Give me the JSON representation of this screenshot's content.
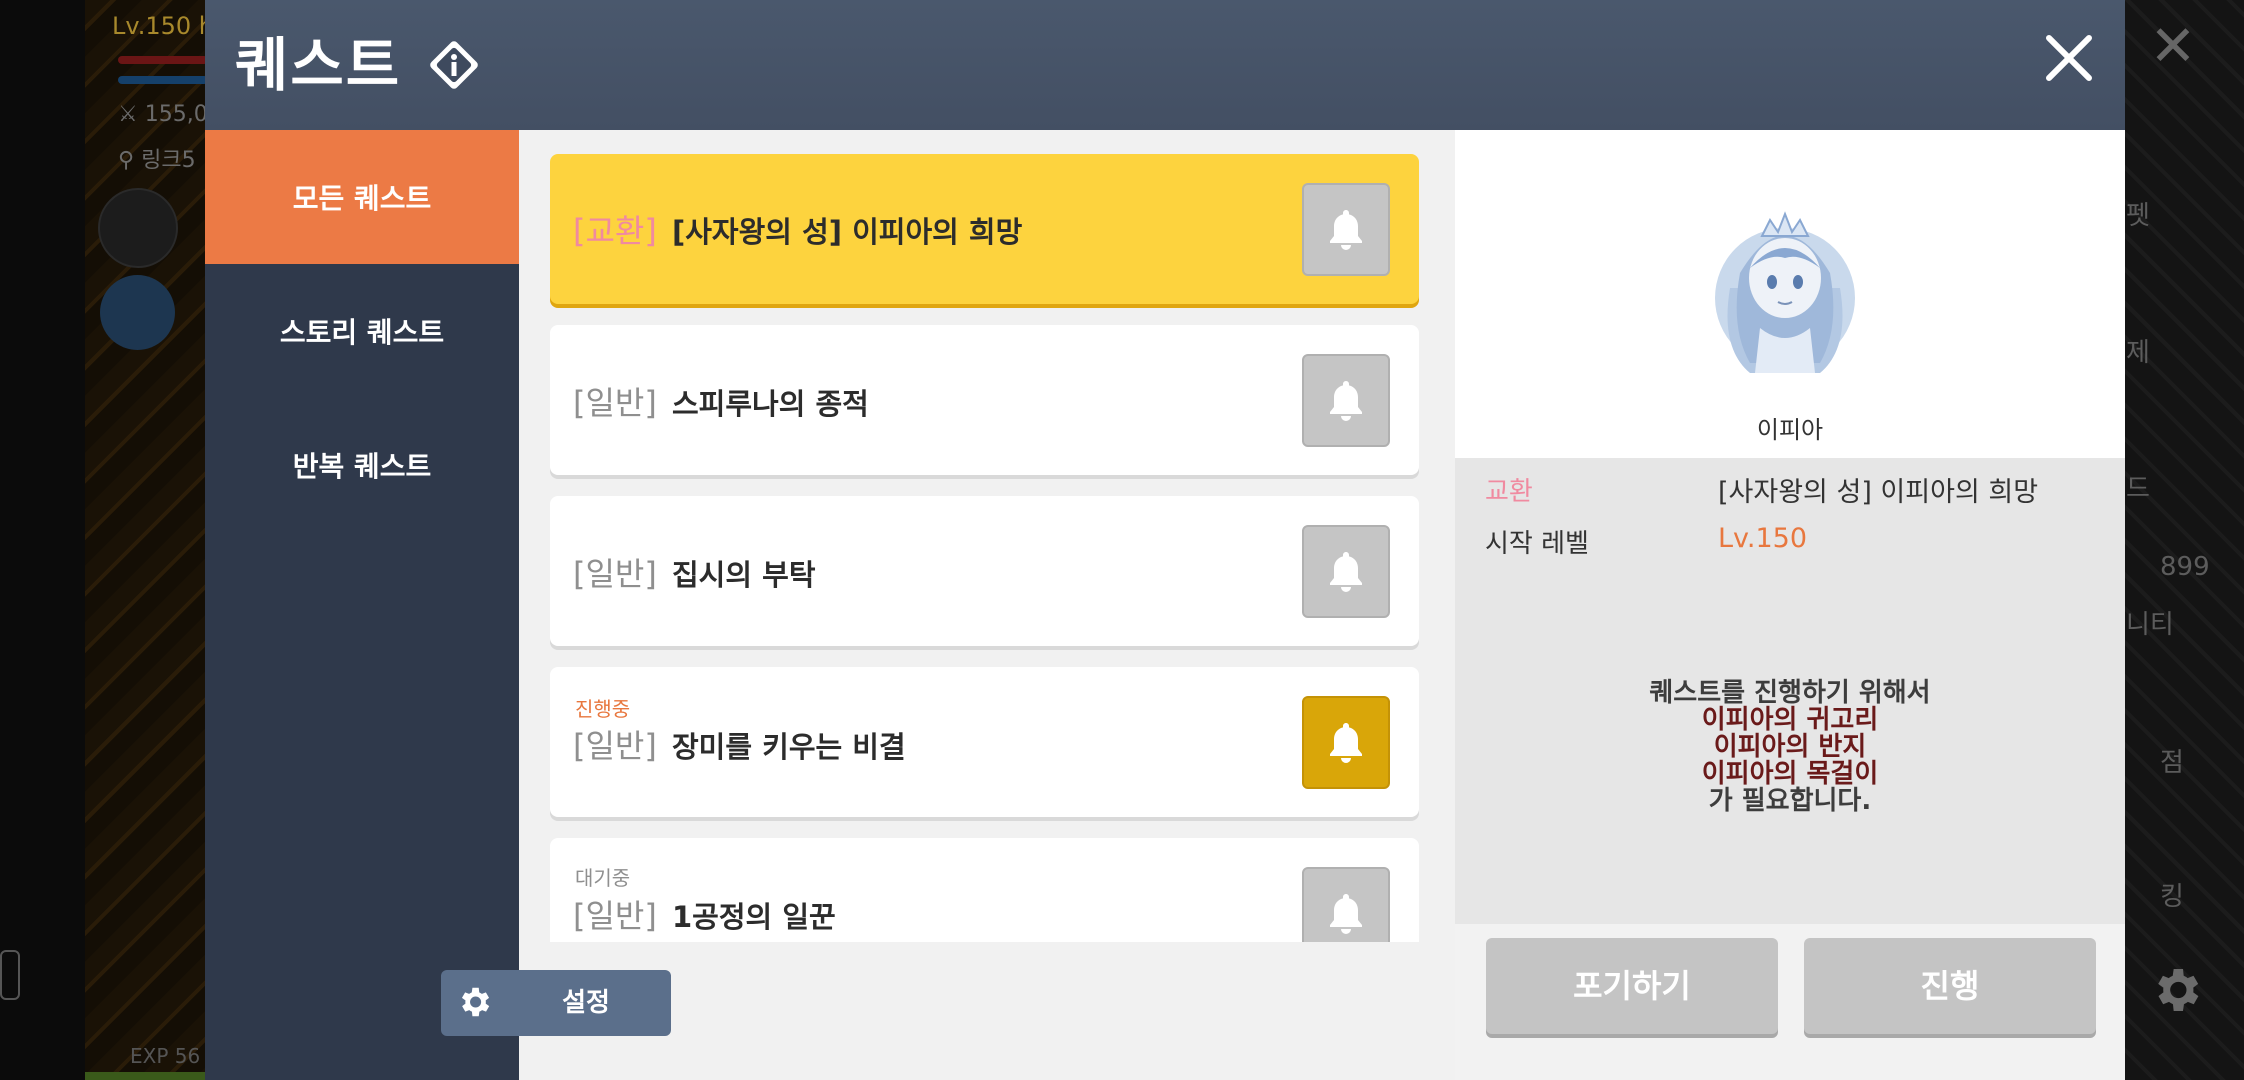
{
  "background": {
    "level_text": "Lv.150 h",
    "power_text": "155,0",
    "location_text": "링크5",
    "exp_text": "EXP  56",
    "right_menu": [
      "펫",
      "제",
      "드",
      "899",
      "니티",
      "점",
      "킹"
    ]
  },
  "dialog": {
    "title": "퀘스트",
    "info_icon": "info-diamond-icon",
    "close_icon": "close-icon"
  },
  "sidebar": {
    "items": [
      {
        "label": "모든 퀘스트",
        "active": true
      },
      {
        "label": "스토리 퀘스트",
        "active": false
      },
      {
        "label": "반복 퀘스트",
        "active": false
      }
    ]
  },
  "quests": [
    {
      "type": "[교환]",
      "name": "[사자왕의 성] 이피아의 희망",
      "status": "",
      "selected": true,
      "alarm_on": false
    },
    {
      "type": "[일반]",
      "name": "스피루나의 종적",
      "status": "",
      "selected": false,
      "alarm_on": false
    },
    {
      "type": "[일반]",
      "name": "집시의 부탁",
      "status": "",
      "selected": false,
      "alarm_on": false
    },
    {
      "type": "[일반]",
      "name": "장미를 키우는 비결",
      "status": "진행중",
      "selected": false,
      "alarm_on": true
    },
    {
      "type": "[일반]",
      "name": "1공정의 일꾼",
      "status": "대기중",
      "selected": false,
      "alarm_on": false
    }
  ],
  "settings_button": {
    "label": "설정",
    "icon": "gear-icon"
  },
  "detail": {
    "npc_name": "이피아",
    "type_label": "교환",
    "quest_title": "[사자왕의 성] 이피아의 희망",
    "start_level_label": "시작 레벨",
    "start_level_value": "Lv.150",
    "requirement_intro": "퀘스트를 진행하기 위해서",
    "requirement_items": [
      "이피아의 귀고리",
      "이피아의 반지",
      "이피아의 목걸이"
    ],
    "requirement_outro": "가 필요합니다.",
    "abandon_label": "포기하기",
    "proceed_label": "진행"
  },
  "colors": {
    "accent_orange": "#ec7a45",
    "selected_card": "#fdd33e",
    "alarm_active": "#d9a609",
    "exchange_pink": "#f08aa0",
    "level_orange": "#e8773e",
    "status_progress": "#e8773e",
    "status_waiting": "#8f8f8f"
  }
}
